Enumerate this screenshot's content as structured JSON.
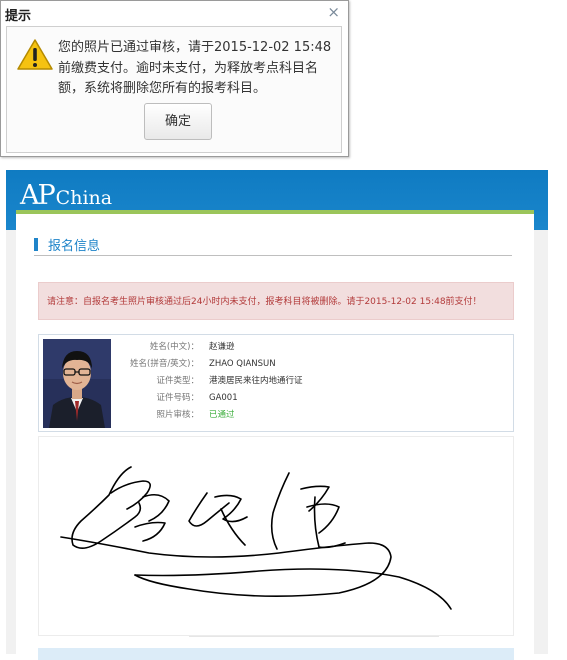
{
  "dialog": {
    "title": "提示",
    "close_glyph": "×",
    "icon": "warning-icon",
    "message": "您的照片已通过审核，请于2015-12-02 15:48前缴费支付。逾时未支付，为释放考点科目名额，系统将删除您所有的报考科目。",
    "ok_label": "确定"
  },
  "header": {
    "logo_ap": "AP",
    "logo_china": "China"
  },
  "section": {
    "title": "报名信息"
  },
  "notice": {
    "text": "请注意：自报名考生照片审核通过后24小时内未支付，报考科目将被删除。请于2015-12-02 15:48前支付！"
  },
  "applicant": {
    "fields": [
      {
        "label": "姓名(中文)：",
        "value": "赵谦逊"
      },
      {
        "label": "姓名(拼音/英文)：",
        "value": "ZHAO QIANSUN"
      },
      {
        "label": "证件类型：",
        "value": "港澳居民来往内地通行证"
      },
      {
        "label": "证件号码：",
        "value": "GA001"
      },
      {
        "label": "照片审核：",
        "value": "已通过"
      }
    ]
  },
  "colors": {
    "header_blue": "#0f7bc2",
    "accent_green": "#9bc55a",
    "section_blue": "#1f84c9",
    "notice_bg": "#f2dede",
    "notice_text": "#b23a3a",
    "status_green": "#3cae3c"
  }
}
